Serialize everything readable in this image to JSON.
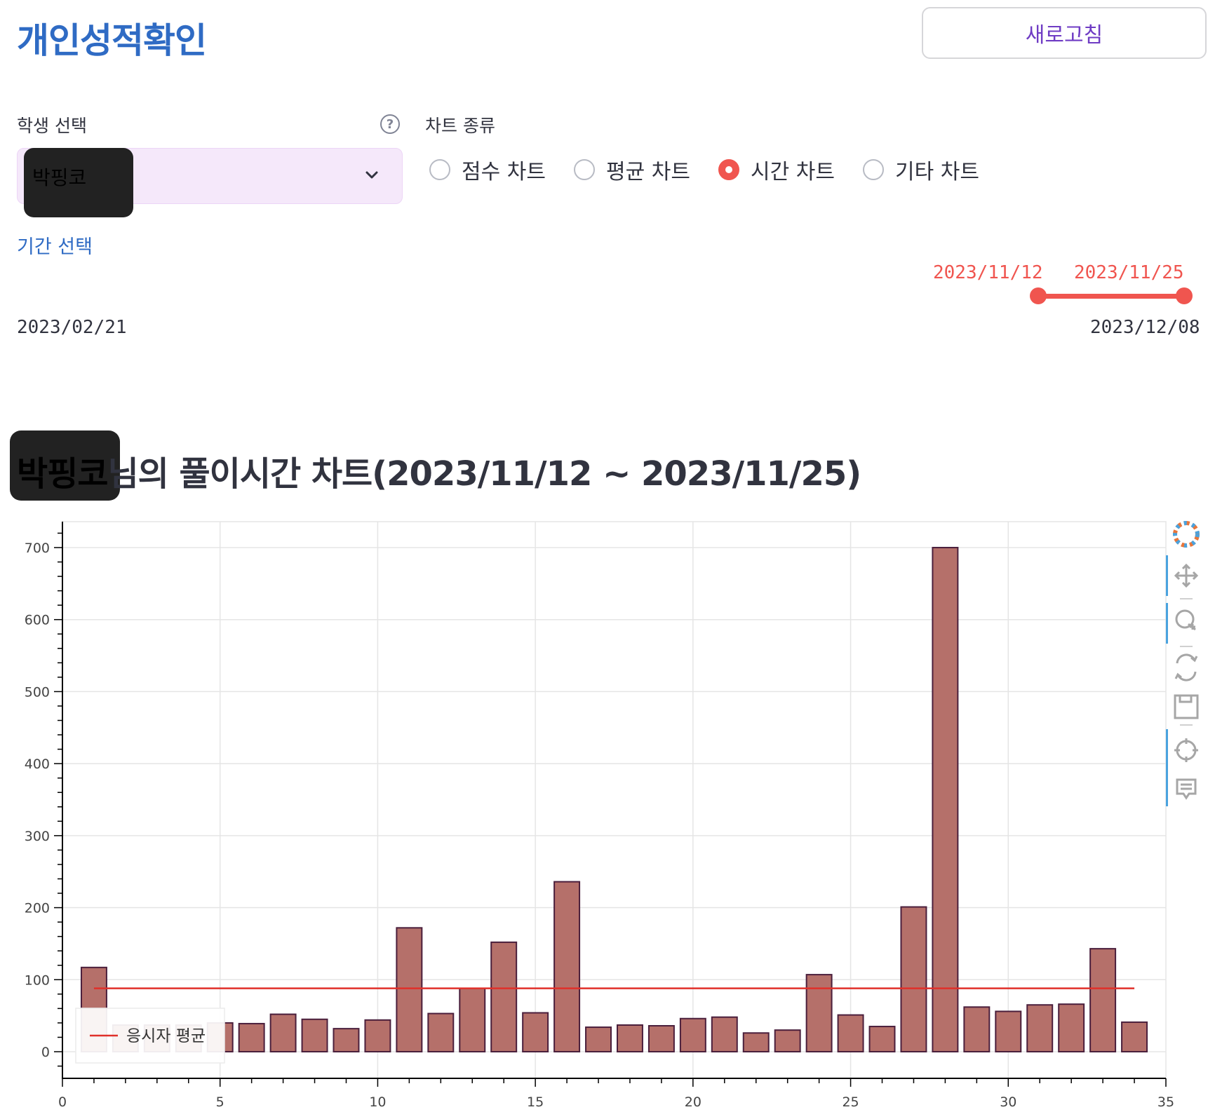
{
  "page": {
    "title": "개인성적확인",
    "refresh_label": "새로고침"
  },
  "student": {
    "label": "학생 선택",
    "help": "?",
    "selected": "박핑코"
  },
  "chart_type": {
    "label": "차트 종류",
    "options": [
      "점수 차트",
      "평균 차트",
      "시간 차트",
      "기타 차트"
    ],
    "selected_index": 2
  },
  "period": {
    "label": "기간 선택",
    "selected_start": "2023/11/12",
    "selected_end": "2023/11/25",
    "min": "2023/02/21",
    "max": "2023/12/08"
  },
  "chart_heading": {
    "name": "박핑코",
    "suffix": "님의 풀이시간 차트(2023/11/12 ~ 2023/11/25)"
  },
  "colors": {
    "accent": "#f0554f",
    "title": "#2f6bc4",
    "bar_fill": "#b5706a",
    "bar_stroke": "#4a1f3c",
    "avg_line": "#e0302a"
  },
  "chart_data": {
    "type": "bar",
    "x": [
      1,
      2,
      3,
      4,
      5,
      6,
      7,
      8,
      9,
      10,
      11,
      12,
      13,
      14,
      15,
      16,
      17,
      18,
      19,
      20,
      21,
      22,
      23,
      24,
      25,
      26,
      27,
      28,
      29,
      30,
      31,
      32,
      33,
      34
    ],
    "values": [
      117,
      37,
      37,
      37,
      40,
      39,
      52,
      45,
      32,
      44,
      172,
      53,
      88,
      152,
      54,
      236,
      34,
      37,
      36,
      46,
      48,
      26,
      30,
      107,
      51,
      35,
      201,
      700,
      62,
      56,
      65,
      66,
      143,
      41
    ],
    "xlim": [
      0,
      35
    ],
    "ylim": [
      -37,
      736
    ],
    "x_ticks": [
      0,
      5,
      10,
      15,
      20,
      25,
      30,
      35
    ],
    "y_ticks": [
      0,
      100,
      200,
      300,
      400,
      500,
      600,
      700
    ],
    "average": {
      "name": "응시자 평균",
      "value": 88,
      "x_range": [
        1,
        34
      ]
    },
    "legend_position": "bottom-left",
    "grid": true,
    "toolbar": [
      "bokeh-logo-icon",
      "pan-icon",
      "wheel-zoom-icon",
      "reset-icon",
      "save-icon",
      "crosshair-icon",
      "hover-icon"
    ]
  }
}
